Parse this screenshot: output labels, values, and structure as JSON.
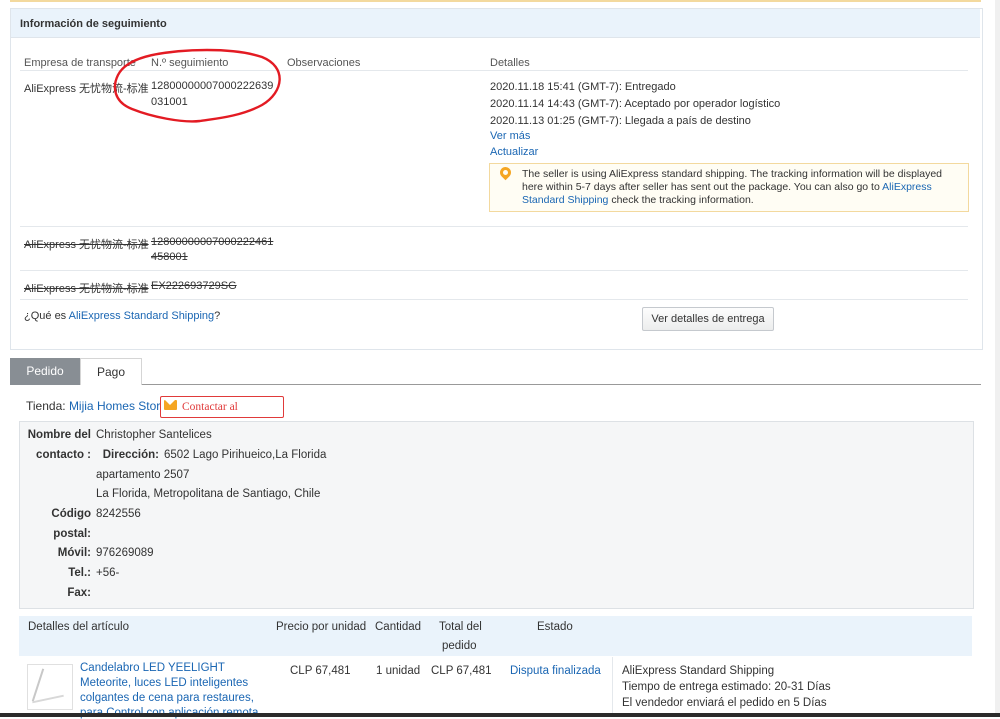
{
  "tracking": {
    "title": "Información de seguimiento",
    "headers": {
      "carrier": "Empresa de transporte",
      "number": "N.º seguimiento",
      "notes": "Observaciones",
      "details": "Detalles"
    },
    "rows": [
      {
        "carrier": "AliExpress 无忧物流-标准",
        "number_line1": "12800000007000222639",
        "number_line2": "031001",
        "events": [
          "2020.11.18 15:41 (GMT-7): Entregado",
          "2020.11.14 14:43 (GMT-7): Aceptado por operador logístico",
          "2020.11.13 01:25 (GMT-7): Llegada a país de destino"
        ],
        "see_more": "Ver más",
        "refresh": "Actualizar"
      },
      {
        "carrier": "AliExpress 无忧物流-标准",
        "number_line1": "12800000007000222461",
        "number_line2": "458001"
      },
      {
        "carrier": "AliExpress 无忧物流-标准",
        "number_line1": "EX222693729SG"
      }
    ],
    "tip": {
      "text1": "The seller is using AliExpress standard shipping. The tracking information will be displayed here within 5-7 days after seller has sent out the package. You can also go to ",
      "link": "AliExpress Standard Shipping",
      "text2": " check the tracking information."
    },
    "question_prefix": "¿Qué es ",
    "question_link": "AliExpress Standard Shipping",
    "question_suffix": "?",
    "delivery_button": "Ver detalles de entrega"
  },
  "tabs": [
    "Pedido",
    "Pago"
  ],
  "store": {
    "label": "Tienda:",
    "name": "Mijia Homes Store",
    "contact": "Contactar al vendedor"
  },
  "address": {
    "name_label_1": "Nombre del",
    "name_label_2": "contacto :",
    "name": "Christopher Santelices",
    "dir_label": "Dirección:",
    "dir_1": "6502 Lago Pirihueico,La Florida",
    "dir_2": "apartamento 2507",
    "dir_3": "La Florida, Metropolitana de Santiago, Chile",
    "zip_label_1": "Código",
    "zip_label_2": "postal:",
    "zip": "8242556",
    "mobile_label": "Móvil:",
    "mobile": "976269089",
    "tel_label": "Tel.:",
    "tel": "+56-",
    "fax_label": "Fax:"
  },
  "items": {
    "headers": {
      "details": "Detalles del artículo",
      "unit_price": "Precio por unidad",
      "qty": "Cantidad",
      "total_1": "Total del",
      "total_2": "pedido",
      "status": "Estado"
    },
    "rows": [
      {
        "title_1": "Candelabro LED YEELIGHT",
        "title_2": "Meteorite, luces LED inteligentes",
        "title_3": "colgantes de cena para restaures,",
        "title_4": "para Control con aplicación remota",
        "unit_price": "CLP 67,481",
        "qty": "1 unidad",
        "total": "CLP 67,481",
        "status": "Disputa finalizada",
        "shipping_1": "AliExpress Standard Shipping",
        "shipping_2": "Tiempo de entrega estimado: 20-31 Días",
        "shipping_3": "El vendedor enviará el pedido en 5 Días"
      }
    ]
  },
  "colors": {
    "link": "#1a66b3",
    "accent_red": "#e03a3a",
    "header_bg": "#eaf3fb",
    "annotation": "#e31b23"
  }
}
